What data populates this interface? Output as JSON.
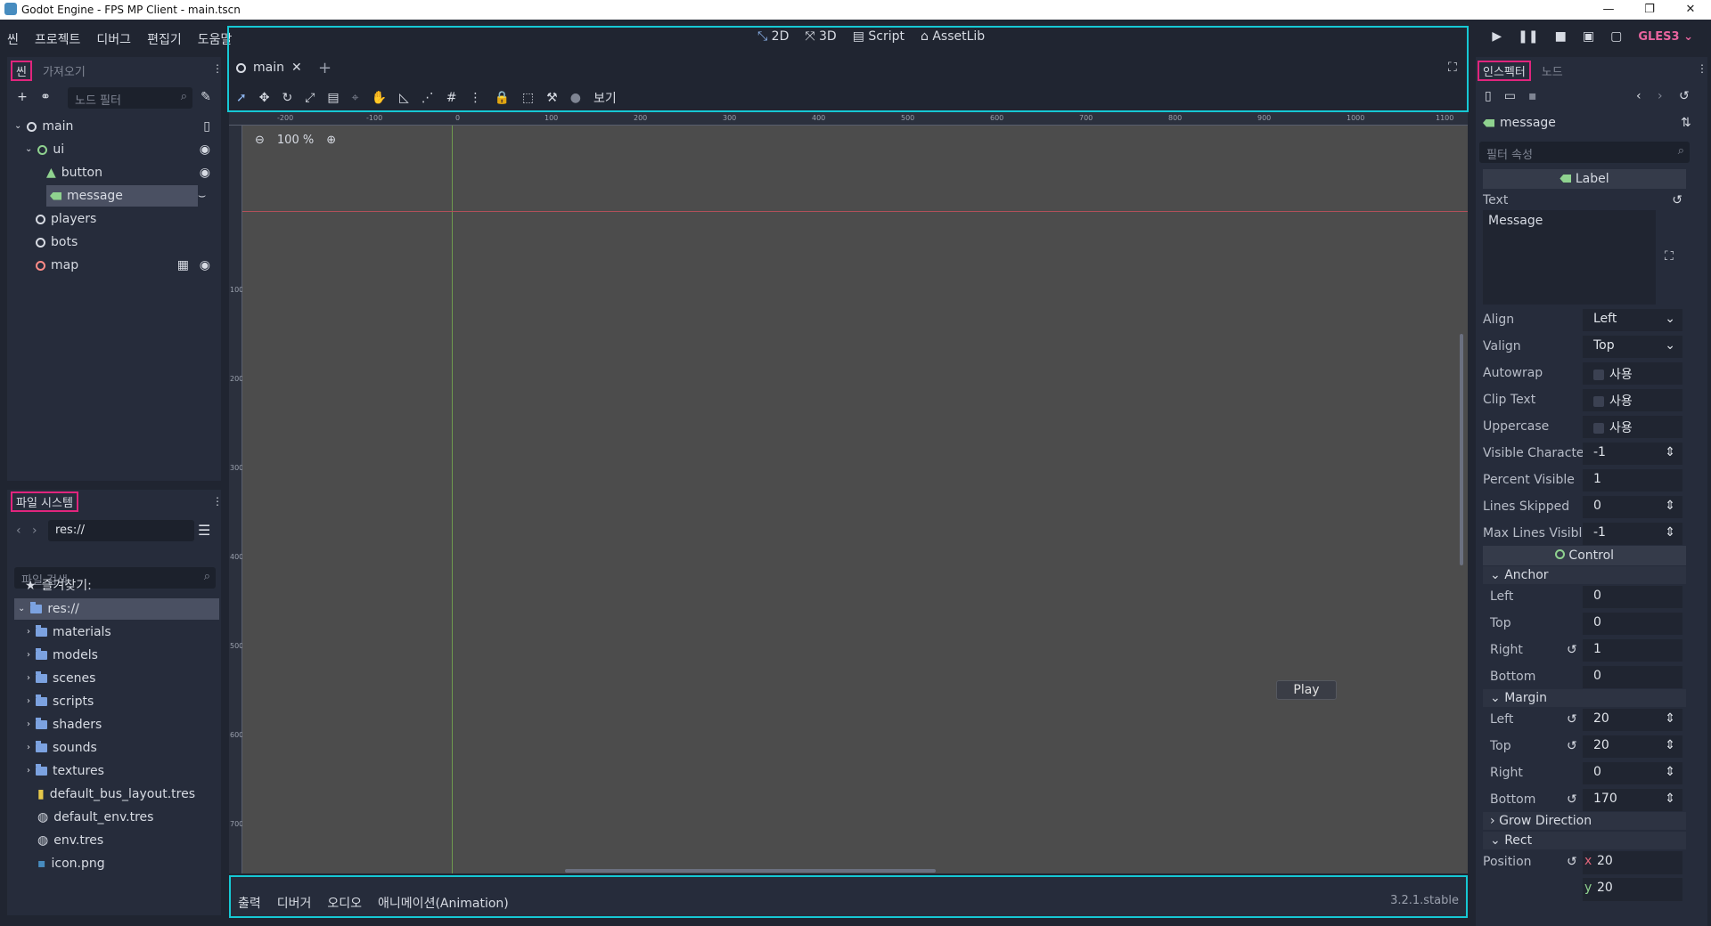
{
  "window": {
    "title": "Godot Engine - FPS MP Client - main.tscn"
  },
  "menu": {
    "items": [
      "씬",
      "프로젝트",
      "디버그",
      "편집기",
      "도움말"
    ]
  },
  "modes": {
    "d2": "2D",
    "d3": "3D",
    "script": "Script",
    "assetlib": "AssetLib"
  },
  "renderer": "GLES3",
  "scene_dock": {
    "tab_scene": "씬",
    "tab_import": "가져오기",
    "filter_placeholder": "노드 필터",
    "nodes": [
      {
        "label": "main"
      },
      {
        "label": "ui"
      },
      {
        "label": "button"
      },
      {
        "label": "message"
      },
      {
        "label": "players"
      },
      {
        "label": "bots"
      },
      {
        "label": "map"
      }
    ]
  },
  "filesystem": {
    "tab": "파일 시스템",
    "path": "res://",
    "search_placeholder": "파일 검색",
    "favorites": "즐겨찾기:",
    "root": "res://",
    "folders": [
      "materials",
      "models",
      "scenes",
      "scripts",
      "shaders",
      "sounds",
      "textures"
    ],
    "files": [
      "default_bus_layout.tres",
      "default_env.tres",
      "env.tres",
      "icon.png"
    ]
  },
  "editor": {
    "tab": "main",
    "zoom": "100 %",
    "view_menu": "보기",
    "play_button": "Play",
    "ruler_h": [
      "-200",
      "-100",
      "0",
      "100",
      "200",
      "300",
      "400",
      "500",
      "600",
      "700",
      "800",
      "900",
      "1000",
      "1100"
    ],
    "ruler_v": [
      "100",
      "200",
      "300",
      "400",
      "500",
      "600",
      "700"
    ]
  },
  "bottom": {
    "tabs": [
      "출력",
      "디버거",
      "오디오",
      "애니메이션(Animation)"
    ],
    "version": "3.2.1.stable"
  },
  "inspector": {
    "tab_inspector": "인스펙터",
    "tab_node": "노드",
    "object": "message",
    "filter_placeholder": "필터 속성",
    "class": "Label",
    "text_label": "Text",
    "text_value": "Message",
    "props": [
      {
        "k": "Align",
        "v": "Left"
      },
      {
        "k": "Valign",
        "v": "Top"
      },
      {
        "k": "Autowrap",
        "v": "사용"
      },
      {
        "k": "Clip Text",
        "v": "사용"
      },
      {
        "k": "Uppercase",
        "v": "사용"
      },
      {
        "k": "Visible Characte",
        "v": "-1"
      },
      {
        "k": "Percent Visible",
        "v": "1"
      },
      {
        "k": "Lines Skipped",
        "v": "0"
      },
      {
        "k": "Max Lines Visibl",
        "v": "-1"
      }
    ],
    "control": "Control",
    "anchor": {
      "title": "Anchor",
      "rows": [
        {
          "k": "Left",
          "v": "0"
        },
        {
          "k": "Top",
          "v": "0"
        },
        {
          "k": "Right",
          "v": "1"
        },
        {
          "k": "Bottom",
          "v": "0"
        }
      ]
    },
    "margin": {
      "title": "Margin",
      "rows": [
        {
          "k": "Left",
          "v": "20"
        },
        {
          "k": "Top",
          "v": "20"
        },
        {
          "k": "Right",
          "v": "0"
        },
        {
          "k": "Bottom",
          "v": "170"
        }
      ]
    },
    "grow": "Grow Direction",
    "rect": "Rect",
    "position_label": "Position",
    "position_x": "20",
    "position_y": "20"
  }
}
